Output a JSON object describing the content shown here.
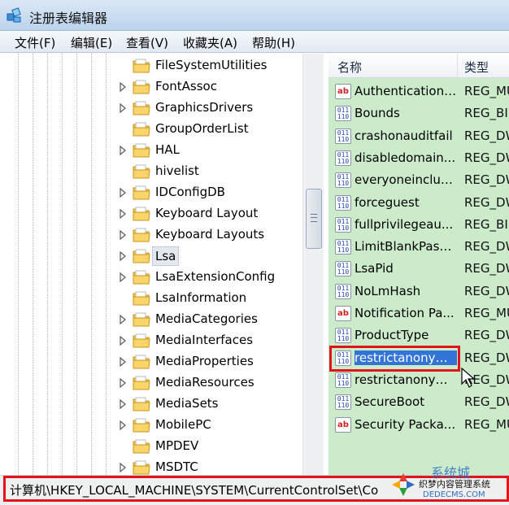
{
  "window": {
    "title": "注册表编辑器",
    "icon": "registry-editor-icon"
  },
  "menu": [
    "文件(F)",
    "编辑(E)",
    "查看(V)",
    "收藏夹(A)",
    "帮助(H)"
  ],
  "tree": {
    "items": [
      {
        "label": "FileSystemUtilities",
        "expandable": false
      },
      {
        "label": "FontAssoc",
        "expandable": true
      },
      {
        "label": "GraphicsDrivers",
        "expandable": true
      },
      {
        "label": "GroupOrderList",
        "expandable": false
      },
      {
        "label": "HAL",
        "expandable": true
      },
      {
        "label": "hivelist",
        "expandable": false
      },
      {
        "label": "IDConfigDB",
        "expandable": true
      },
      {
        "label": "Keyboard Layout",
        "expandable": true
      },
      {
        "label": "Keyboard Layouts",
        "expandable": true
      },
      {
        "label": "Lsa",
        "expandable": true,
        "selected": true
      },
      {
        "label": "LsaExtensionConfig",
        "expandable": true
      },
      {
        "label": "LsaInformation",
        "expandable": false
      },
      {
        "label": "MediaCategories",
        "expandable": true
      },
      {
        "label": "MediaInterfaces",
        "expandable": true
      },
      {
        "label": "MediaProperties",
        "expandable": true
      },
      {
        "label": "MediaResources",
        "expandable": true
      },
      {
        "label": "MediaSets",
        "expandable": true
      },
      {
        "label": "MobilePC",
        "expandable": true
      },
      {
        "label": "MPDEV",
        "expandable": false
      },
      {
        "label": "MSDTC",
        "expandable": true
      }
    ]
  },
  "list": {
    "columns": [
      "名称",
      "类型"
    ],
    "rows": [
      {
        "name": "Authentication ...",
        "type": "REG_MU",
        "icon": "ab"
      },
      {
        "name": "Bounds",
        "type": "REG_BIN",
        "icon": "bin"
      },
      {
        "name": "crashonauditfail",
        "type": "REG_DW",
        "icon": "bin"
      },
      {
        "name": "disabledomain...",
        "type": "REG_DW",
        "icon": "bin"
      },
      {
        "name": "everyoneinclud...",
        "type": "REG_DW",
        "icon": "bin"
      },
      {
        "name": "forceguest",
        "type": "REG_DW",
        "icon": "bin"
      },
      {
        "name": "fullprivilegeau...",
        "type": "REG_BIN",
        "icon": "bin"
      },
      {
        "name": "LimitBlankPass...",
        "type": "REG_DW",
        "icon": "bin"
      },
      {
        "name": "LsaPid",
        "type": "REG_DW",
        "icon": "bin"
      },
      {
        "name": "NoLmHash",
        "type": "REG_DW",
        "icon": "bin"
      },
      {
        "name": "Notification Pa...",
        "type": "REG_MU",
        "icon": "ab"
      },
      {
        "name": "ProductType",
        "type": "REG_DW",
        "icon": "bin"
      },
      {
        "name": "restrictanonym...",
        "type": "REG_DW",
        "icon": "bin",
        "highlighted": true
      },
      {
        "name": "restrictanonym...",
        "type": "REG_DW",
        "icon": "bin"
      },
      {
        "name": "SecureBoot",
        "type": "REG_DW",
        "icon": "bin"
      },
      {
        "name": "Security Packa...",
        "type": "REG_MU",
        "icon": "ab"
      }
    ]
  },
  "status": {
    "path": "计算机\\HKEY_LOCAL_MACHINE\\SYSTEM\\CurrentControlSet\\Co"
  },
  "watermark": {
    "brand": "系统城",
    "site_name": "织梦内容管理系统",
    "url": "DEDECMS.COM"
  },
  "icon_text": {
    "ab": "ab",
    "bin": "011\n110"
  },
  "colors": {
    "list_background": "#ccebcb",
    "selection": "#3375d6",
    "annotation_red": "#e0141b",
    "folder": "#f2c750"
  }
}
